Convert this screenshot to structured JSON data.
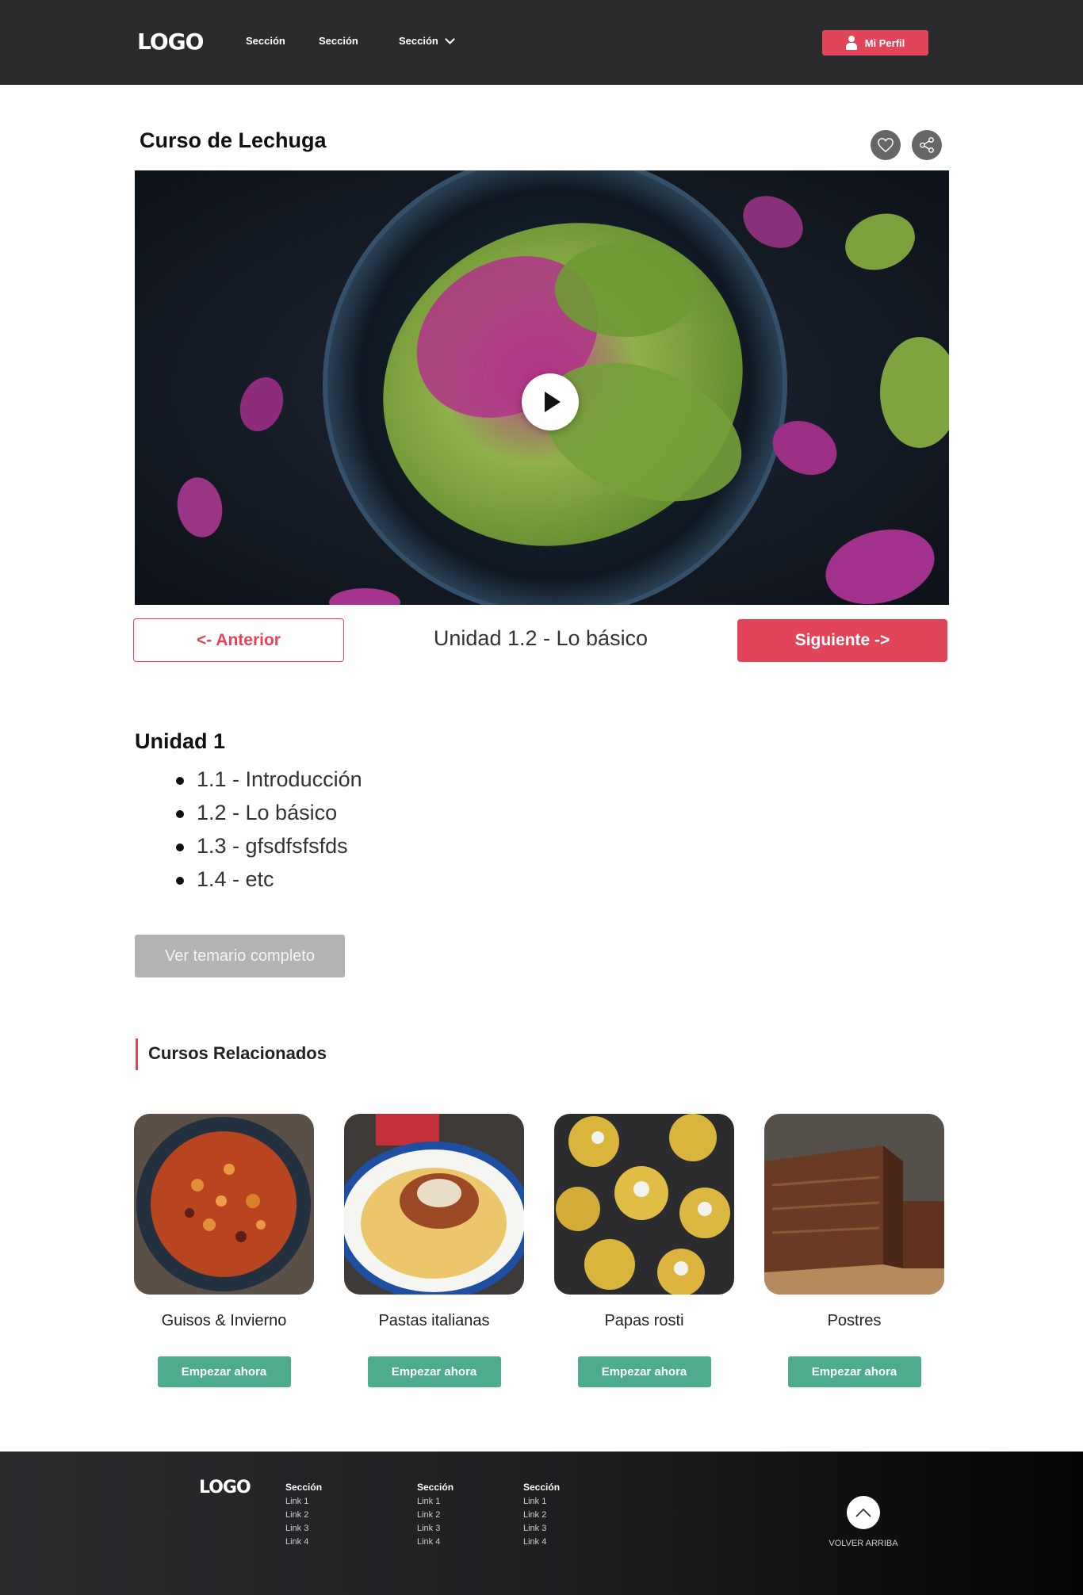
{
  "header": {
    "logo": "LOGO",
    "nav": [
      "Sección",
      "Sección",
      "Sección"
    ],
    "profile_label": "Mi Perfil"
  },
  "course": {
    "title": "Curso de Lechuga"
  },
  "lesson_nav": {
    "prev_label": "<- Anterior",
    "current": "Unidad 1.2 - Lo básico",
    "next_label": "Siguiente ->"
  },
  "syllabus": {
    "unit_title": "Unidad 1",
    "lessons": [
      "1.1 - Introducción",
      "1.2 - Lo básico",
      "1.3 - gfsdfsfsfds",
      "1.4 - etc"
    ],
    "button_label": "Ver temario completo"
  },
  "related": {
    "title": "Cursos Relacionados",
    "cards": [
      {
        "title": "Guisos & Invierno",
        "button": "Empezar ahora"
      },
      {
        "title": "Pastas italianas",
        "button": "Empezar ahora"
      },
      {
        "title": "Papas rosti",
        "button": "Empezar ahora"
      },
      {
        "title": "Postres",
        "button": "Empezar ahora"
      }
    ]
  },
  "footer": {
    "logo": "LOGO",
    "columns": [
      {
        "heading": "Sección",
        "links": [
          "Link 1",
          "Link 2",
          "Link 3",
          "Link 4"
        ]
      },
      {
        "heading": "Sección",
        "links": [
          "Link 1",
          "Link 2",
          "Link 3",
          "Link 4"
        ]
      },
      {
        "heading": "Sección",
        "links": [
          "Link 1",
          "Link 2",
          "Link 3",
          "Link 4"
        ]
      }
    ],
    "back_to_top": "VOLVER ARRIBA"
  },
  "colors": {
    "header_bg": "#2b2b2e",
    "accent": "#e2455a",
    "action": "#4fab8e",
    "disabled": "#b3b3b3"
  },
  "icons": [
    "chevron-down-icon",
    "user-icon",
    "heart-icon",
    "share-icon",
    "play-icon",
    "chevron-up-icon"
  ]
}
